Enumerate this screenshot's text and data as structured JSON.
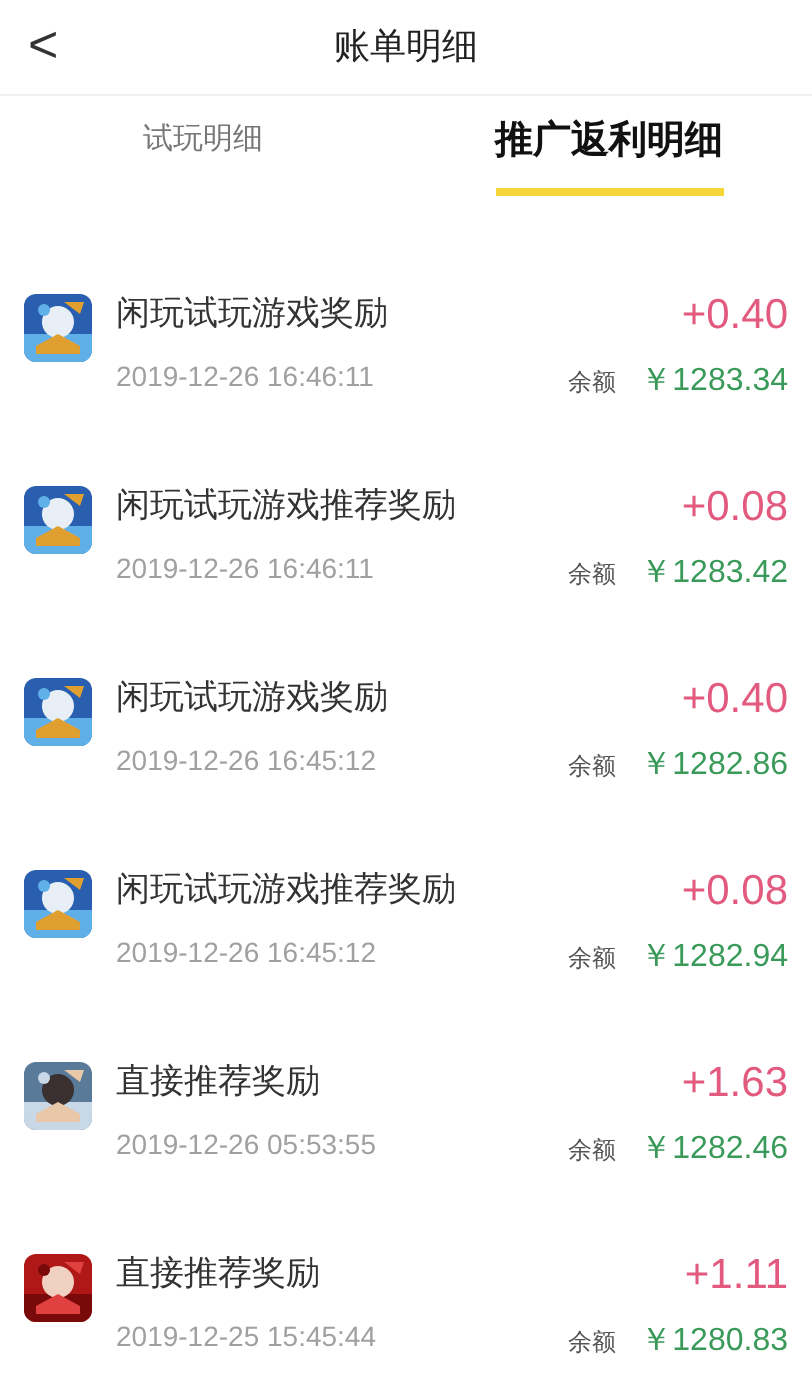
{
  "header": {
    "back": "<",
    "title": "账单明细"
  },
  "tabs": [
    {
      "label": "试玩明细",
      "selected": false
    },
    {
      "label": "推广返利明细",
      "selected": true
    }
  ],
  "records": [
    {
      "title": "闲玩试玩游戏奖励",
      "time": "2019-12-26 16:46:11",
      "amount": "+0.40",
      "balance_label": "余额",
      "balance": "￥1283.34"
    },
    {
      "title": "闲玩试玩游戏推荐奖励",
      "time": "2019-12-26 16:46:11",
      "amount": "+0.08",
      "balance_label": "余额",
      "balance": "￥1283.42"
    },
    {
      "title": "闲玩试玩游戏奖励",
      "time": "2019-12-26 16:45:12",
      "amount": "+0.40",
      "balance_label": "余额",
      "balance": "￥1282.86"
    },
    {
      "title": "闲玩试玩游戏推荐奖励",
      "time": "2019-12-26 16:45:12",
      "amount": "+0.08",
      "balance_label": "余额",
      "balance": "￥1282.94"
    },
    {
      "title": "直接推荐奖励",
      "time": "2019-12-26 05:53:55",
      "amount": "+1.63",
      "balance_label": "余额",
      "balance": "￥1282.46"
    },
    {
      "title": "直接推荐奖励",
      "time": "2019-12-25 15:45:44",
      "amount": "+1.11",
      "balance_label": "余额",
      "balance": "￥1280.83"
    }
  ]
}
